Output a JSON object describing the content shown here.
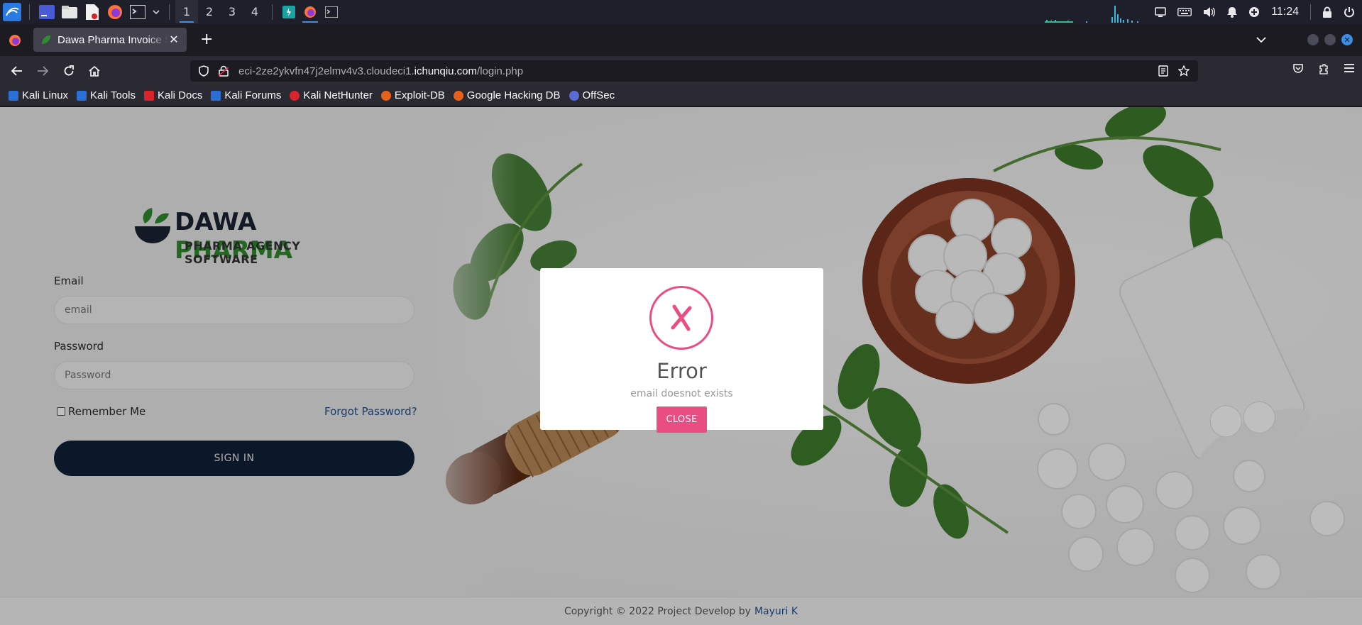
{
  "taskbar": {
    "workspaces": [
      "1",
      "2",
      "3",
      "4"
    ],
    "active_workspace": "1",
    "clock": "11:24"
  },
  "browser": {
    "tab_title": "Dawa Pharma Invoice System",
    "url_prefix": "eci-2ze2ykvfn47j2elmv4v3.cloudeci1.",
    "url_host": "ichunqiu.com",
    "url_path": "/login.php",
    "bookmarks": [
      {
        "label": "Kali Linux",
        "color": "#2a6fd6"
      },
      {
        "label": "Kali Tools",
        "color": "#2a6fd6"
      },
      {
        "label": "Kali Docs",
        "color": "#d9232a"
      },
      {
        "label": "Kali Forums",
        "color": "#2a6fd6"
      },
      {
        "label": "Kali NetHunter",
        "color": "#d9232a"
      },
      {
        "label": "Exploit-DB",
        "color": "#e8611a"
      },
      {
        "label": "Google Hacking DB",
        "color": "#e8611a"
      },
      {
        "label": "OffSec",
        "color": "#5b6bd6"
      }
    ]
  },
  "page": {
    "logo": {
      "name_dark": "DAWA",
      "name_green": "PHARMA",
      "tagline": "PHARMA AGENCY SOFTWARE"
    },
    "form": {
      "email_label": "Email",
      "email_placeholder": "email",
      "password_label": "Password",
      "password_placeholder": "Password",
      "remember_label": "Remember Me",
      "forgot_label": "Forgot Password?",
      "signin_label": "SIGN IN"
    },
    "footer": {
      "text": "Copyright © 2022 Project Develop by",
      "author": "Mayuri K"
    },
    "modal": {
      "title": "Error",
      "message": "email doesnot exists",
      "close_label": "CLOSE",
      "accent": "#e94e83"
    }
  }
}
